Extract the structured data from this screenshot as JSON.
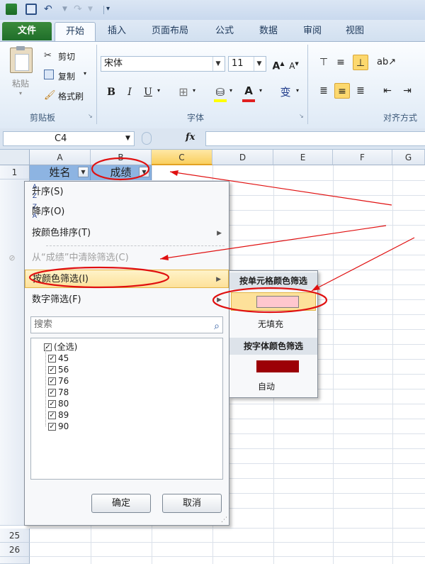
{
  "tabs": {
    "file": "文件",
    "home": "开始",
    "insert": "插入",
    "layout": "页面布局",
    "formula": "公式",
    "data": "数据",
    "review": "审阅",
    "view": "视图"
  },
  "clipboard": {
    "paste": "粘贴",
    "cut": "剪切",
    "copy": "复制",
    "format_painter": "格式刷",
    "label": "剪贴板"
  },
  "font": {
    "name": "宋体",
    "size": "11",
    "label": "字体",
    "bold": "B",
    "italic": "I",
    "underline": "U",
    "wen": "变"
  },
  "alignment": {
    "label": "对齐方式"
  },
  "formula_bar": {
    "name_box": "C4",
    "fx": "fx"
  },
  "grid": {
    "columns": [
      "A",
      "B",
      "C",
      "D",
      "E",
      "F",
      "G"
    ],
    "row1": "1",
    "row25": "25",
    "row26": "26",
    "header_a1": "姓名",
    "header_b1": "成绩"
  },
  "filter_menu": {
    "sort_asc": "升序(S)",
    "sort_desc": "降序(O)",
    "sort_by_color": "按颜色排序(T)",
    "clear_filter": "从“成绩”中清除筛选(C)",
    "filter_by_color": "按颜色筛选(I)",
    "number_filter": "数字筛选(F)",
    "search_placeholder": "搜索",
    "select_all": "(全选)",
    "values": [
      "45",
      "56",
      "76",
      "78",
      "80",
      "89",
      "90"
    ],
    "ok": "确定",
    "cancel": "取消"
  },
  "color_submenu": {
    "cell_color_heading": "按单元格颜色筛选",
    "no_fill": "无填充",
    "font_color_heading": "按字体颜色筛选",
    "auto": "自动",
    "cell_color_swatch": "#ffc7ce",
    "font_color_swatch": "#9c0006"
  },
  "colors": {
    "header_fill": "#8db4e2",
    "annotation_red": "#e01010",
    "highlight": "#fde19a"
  }
}
